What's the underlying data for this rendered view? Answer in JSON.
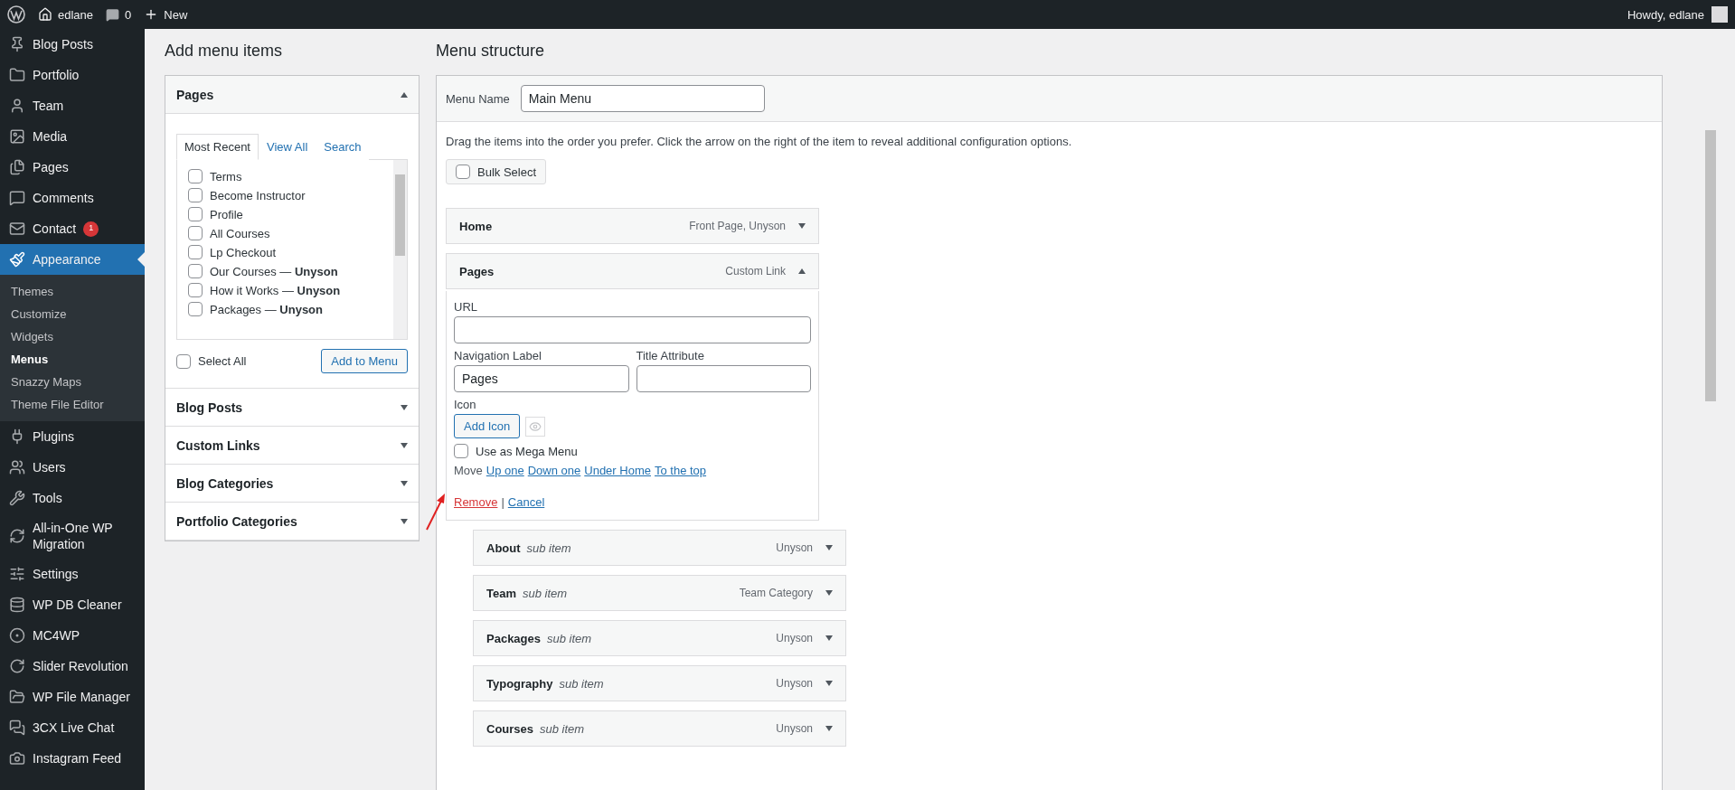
{
  "admin_bar": {
    "site": "edlane",
    "comments": "0",
    "new": "New",
    "greeting": "Howdy, edlane"
  },
  "sidebar": {
    "items": [
      {
        "label": "Blog Posts",
        "selected": false
      },
      {
        "label": "Portfolio",
        "selected": false
      },
      {
        "label": "Team",
        "selected": false
      },
      {
        "label": "Media",
        "selected": false
      },
      {
        "label": "Pages",
        "selected": false
      },
      {
        "label": "Comments",
        "selected": false
      },
      {
        "label": "Contact",
        "selected": false,
        "badge": "1"
      },
      {
        "label": "Appearance",
        "selected": true,
        "children": [
          {
            "label": "Themes",
            "selected": false
          },
          {
            "label": "Customize",
            "selected": false
          },
          {
            "label": "Widgets",
            "selected": false
          },
          {
            "label": "Menus",
            "selected": true
          },
          {
            "label": "Snazzy Maps",
            "selected": false
          },
          {
            "label": "Theme File Editor",
            "selected": false
          }
        ]
      },
      {
        "label": "Plugins",
        "selected": false
      },
      {
        "label": "Users",
        "selected": false
      },
      {
        "label": "Tools",
        "selected": false
      },
      {
        "label": "All-in-One WP Migration",
        "selected": false
      },
      {
        "label": "Settings",
        "selected": false
      },
      {
        "label": "WP DB Cleaner",
        "selected": false
      },
      {
        "label": "MC4WP",
        "selected": false
      },
      {
        "label": "Slider Revolution",
        "selected": false
      },
      {
        "label": "WP File Manager",
        "selected": false
      },
      {
        "label": "3CX Live Chat",
        "selected": false
      },
      {
        "label": "Instagram Feed",
        "selected": false
      }
    ]
  },
  "add_items": {
    "title": "Add menu items",
    "sections": [
      {
        "title": "Pages",
        "expanded": true,
        "tabs": [
          {
            "label": "Most Recent",
            "selected": true
          },
          {
            "label": "View All",
            "selected": false
          },
          {
            "label": "Search",
            "selected": false
          }
        ],
        "items": [
          {
            "label": "Terms",
            "checked": false
          },
          {
            "label": "Become Instructor",
            "checked": false
          },
          {
            "label": "Profile",
            "checked": false
          },
          {
            "label": "All Courses",
            "checked": false
          },
          {
            "label": "Lp Checkout",
            "checked": false
          },
          {
            "label": "Our Courses — **Unyson**",
            "checked": false
          },
          {
            "label": "How it Works — **Unyson**",
            "checked": false
          },
          {
            "label": "Packages — **Unyson**",
            "checked": false
          }
        ],
        "select_all": {
          "label": "Select All",
          "checked": false
        },
        "button": "Add to Menu"
      },
      {
        "title": "Blog Posts",
        "expanded": false
      },
      {
        "title": "Custom Links",
        "expanded": false
      },
      {
        "title": "Blog Categories",
        "expanded": false
      },
      {
        "title": "Portfolio Categories",
        "expanded": false
      }
    ]
  },
  "menu_structure": {
    "title": "Menu structure",
    "menu_name": {
      "label": "Menu Name",
      "value": "Main Menu"
    },
    "instructions": "Drag the items into the order you prefer. Click the arrow on the right of the item to reveal additional configuration options.",
    "bulk_select": {
      "label": "Bulk Select",
      "checked": false
    },
    "items": [
      {
        "title": "Home",
        "type": "Front Page, Unyson",
        "expanded": false
      },
      {
        "title": "Pages",
        "type": "Custom Link",
        "expanded": true,
        "settings": {
          "url": {
            "label": "URL"
          },
          "nav_label": {
            "label": "Navigation Label",
            "value": "Pages"
          },
          "title_attr": {
            "label": "Title Attribute"
          },
          "icon": {
            "label": "Icon",
            "button": "Add Icon"
          },
          "mega_menu": {
            "label": "Use as Mega Menu",
            "checked": false
          },
          "move": {
            "label": "Move",
            "links": [
              "Up one",
              "Down one",
              "Under Home",
              "To the top"
            ]
          },
          "remove": "Remove",
          "separator": "|",
          "cancel": "Cancel"
        },
        "children": [
          {
            "title": "About",
            "note": "sub item",
            "type": "Unyson",
            "expanded": false
          },
          {
            "title": "Team",
            "note": "sub item",
            "type": "Team Category",
            "expanded": false
          },
          {
            "title": "Packages",
            "note": "sub item",
            "type": "Unyson",
            "expanded": false
          },
          {
            "title": "Typography",
            "note": "sub item",
            "type": "Unyson",
            "expanded": false
          },
          {
            "title": "Courses",
            "note": "sub item",
            "type": "Unyson",
            "expanded": false
          }
        ]
      }
    ]
  }
}
